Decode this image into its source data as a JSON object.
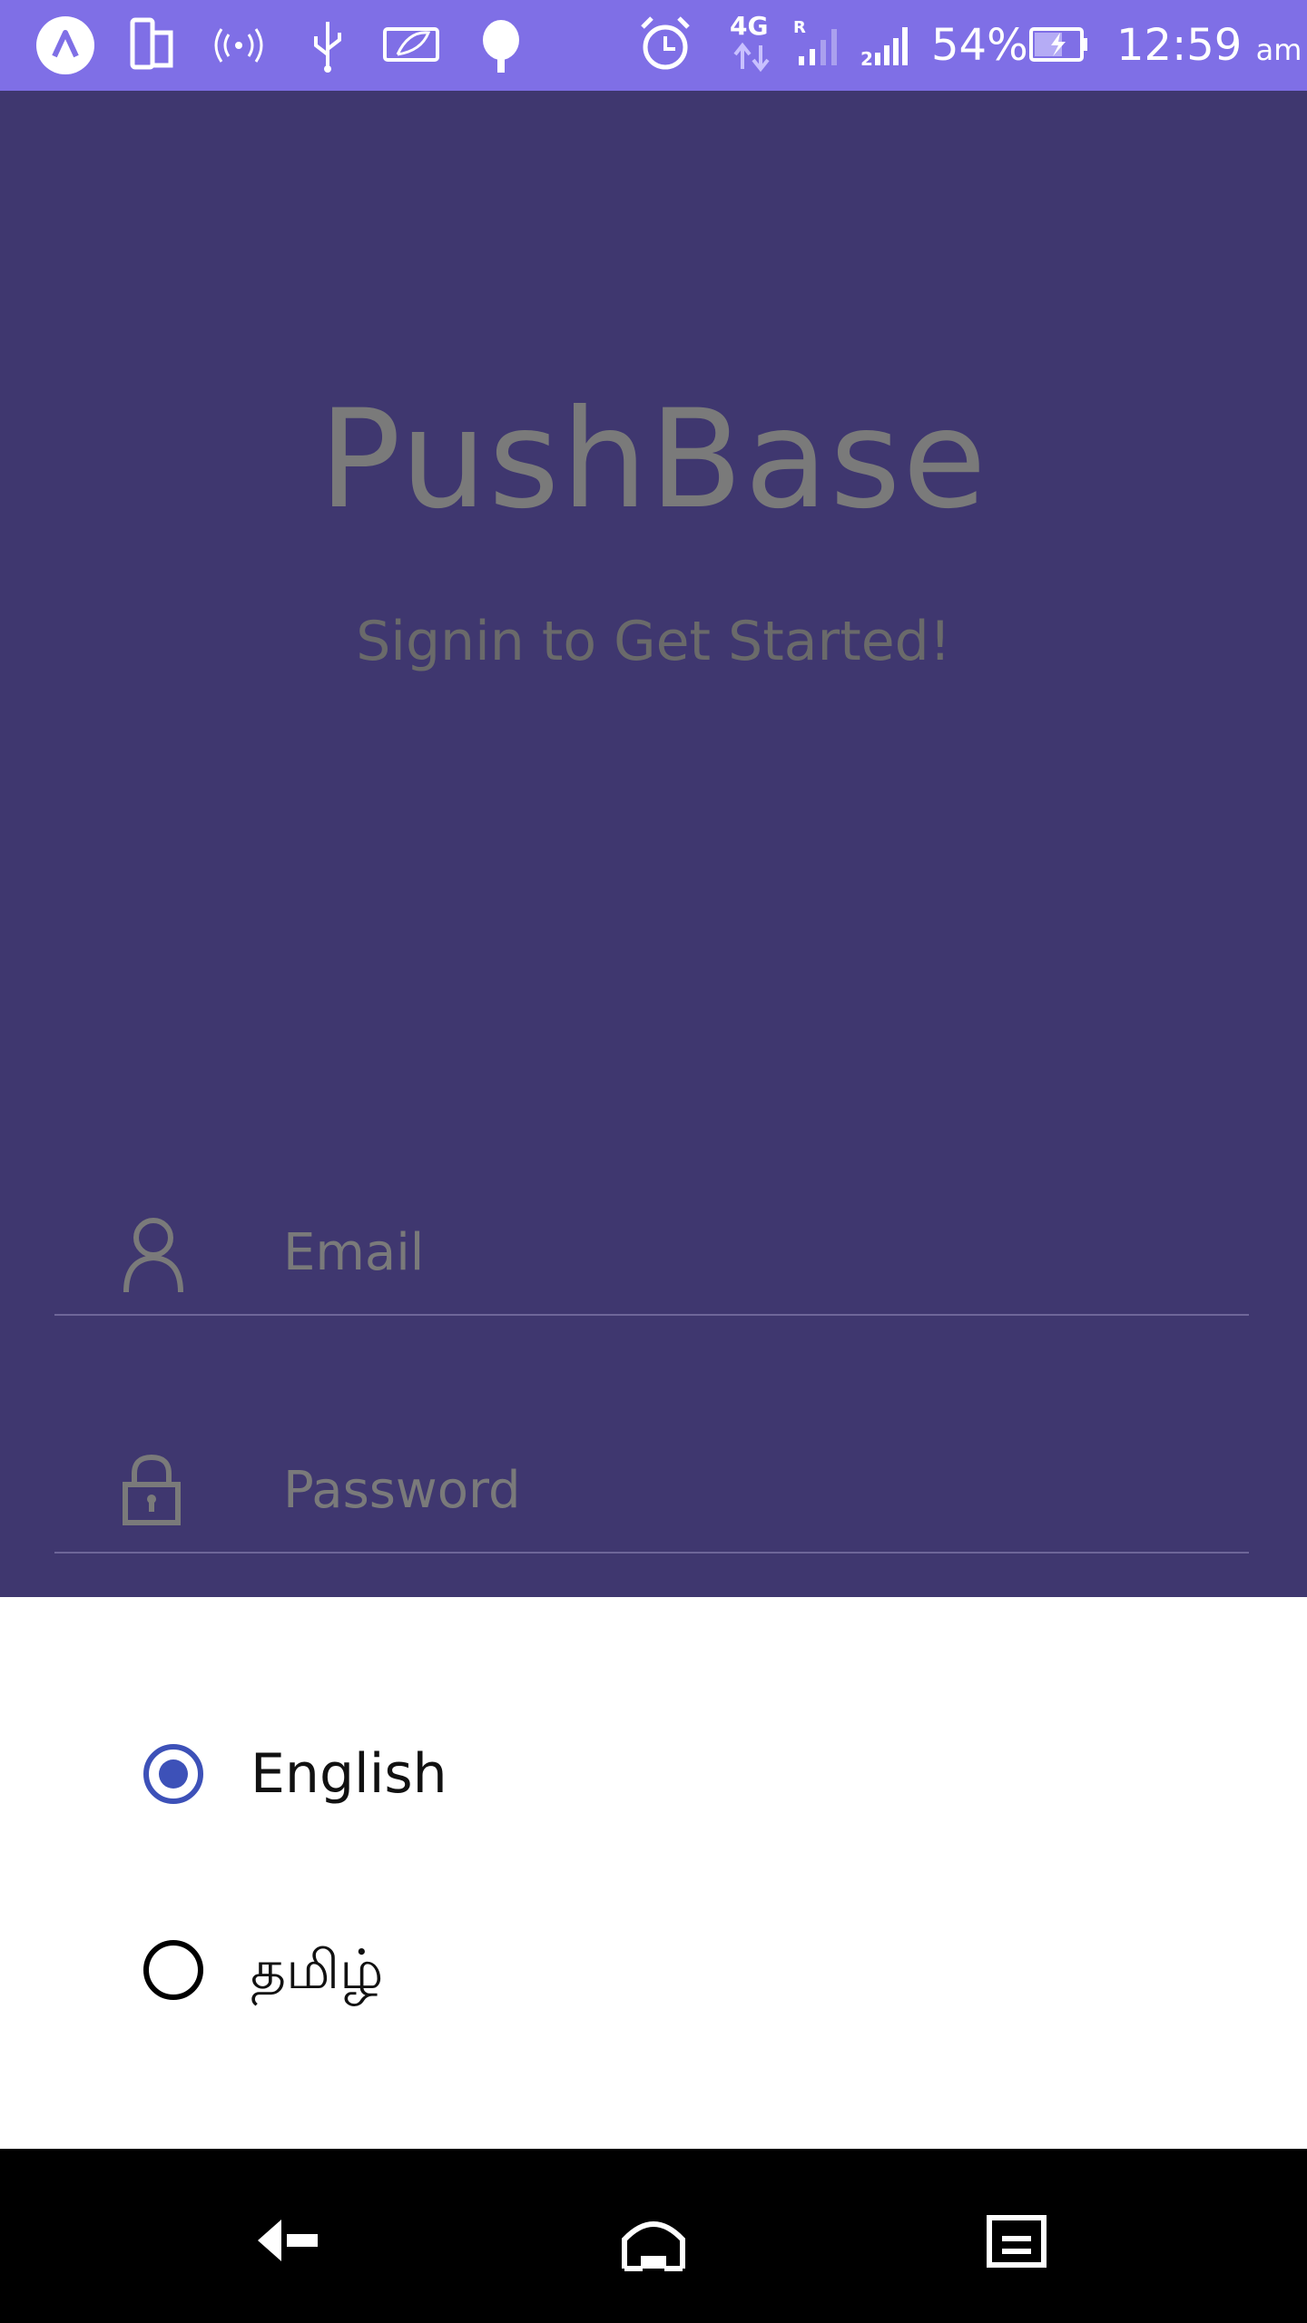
{
  "status_bar": {
    "battery_percent": "54%",
    "time": "12:59",
    "time_suffix": "am",
    "network_label": "4G"
  },
  "app": {
    "title": "PushBase",
    "subtitle": "Signin to Get Started!"
  },
  "form": {
    "email_placeholder": "Email",
    "password_placeholder": "Password"
  },
  "language_sheet": {
    "options": [
      {
        "label": "English",
        "selected": true
      },
      {
        "label": "தமிழ்",
        "selected": false
      }
    ]
  },
  "colors": {
    "status_bar": "#7f6fe6",
    "background": "#3f376f",
    "accent": "#3d51b8"
  }
}
